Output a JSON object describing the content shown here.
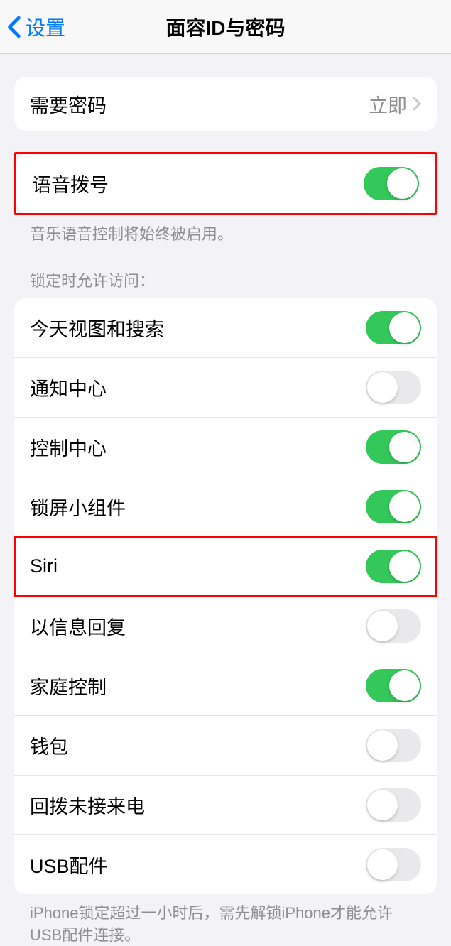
{
  "nav": {
    "back_label": "设置",
    "title": "面容ID与密码"
  },
  "require_passcode": {
    "label": "需要密码",
    "value": "立即"
  },
  "voice_dial": {
    "label": "语音拨号",
    "enabled": true,
    "footer": "音乐语音控制将始终被启用。"
  },
  "lock_access": {
    "header": "锁定时允许访问：",
    "items": [
      {
        "label": "今天视图和搜索",
        "enabled": true
      },
      {
        "label": "通知中心",
        "enabled": false
      },
      {
        "label": "控制中心",
        "enabled": true
      },
      {
        "label": "锁屏小组件",
        "enabled": true
      },
      {
        "label": "Siri",
        "enabled": true
      },
      {
        "label": "以信息回复",
        "enabled": false
      },
      {
        "label": "家庭控制",
        "enabled": true
      },
      {
        "label": "钱包",
        "enabled": false
      },
      {
        "label": "回拨未接来电",
        "enabled": false
      },
      {
        "label": "USB配件",
        "enabled": false
      }
    ],
    "footer": "iPhone锁定超过一小时后，需先解锁iPhone才能允许USB配件连接。"
  }
}
